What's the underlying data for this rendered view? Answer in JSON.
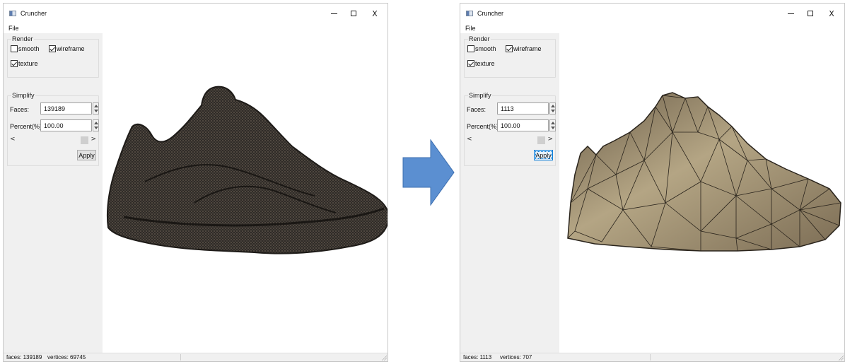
{
  "colors": {
    "arrow": "#5b8fd1",
    "arrow_edge": "#3d6fb0",
    "mesh_fill_right": "#9a8a6e",
    "mesh_fill_left": "#2e2a26"
  },
  "windows": [
    {
      "title": "Cruncher",
      "menu": {
        "file": "File"
      },
      "render_group": {
        "title": "Render",
        "smooth": "smooth",
        "smooth_checked": false,
        "wireframe": "wireframe",
        "wireframe_checked": true,
        "texture": "texture",
        "texture_checked": true
      },
      "simplify_group": {
        "title": "Simplify",
        "faces_label": "Faces:",
        "faces_value": "139189",
        "percent_label": "Percent(%):",
        "percent_value": "100.00",
        "slider_left": "<",
        "slider_right": ">",
        "apply": "Apply"
      },
      "status": {
        "faces": "faces: 139189",
        "vertices": "vertices: 69745"
      },
      "icons": {
        "minimize": "minimize-icon",
        "maximize": "maximize-icon",
        "close": "close-icon",
        "close_glyph": "X"
      }
    },
    {
      "title": "Cruncher",
      "menu": {
        "file": "File"
      },
      "render_group": {
        "title": "Render",
        "smooth": "smooth",
        "smooth_checked": false,
        "wireframe": "wireframe",
        "wireframe_checked": true,
        "texture": "texture",
        "texture_checked": true
      },
      "simplify_group": {
        "title": "Simplify",
        "faces_label": "Faces:",
        "faces_value": "1113",
        "percent_label": "Percent(%):",
        "percent_value": "100.00",
        "slider_left": "<",
        "slider_right": ">",
        "apply": "Apply"
      },
      "status": {
        "faces": "faces: 1113",
        "vertices": "vertices: 707"
      },
      "icons": {
        "minimize": "minimize-icon",
        "maximize": "maximize-icon",
        "close": "close-icon",
        "close_glyph": "X"
      }
    }
  ]
}
